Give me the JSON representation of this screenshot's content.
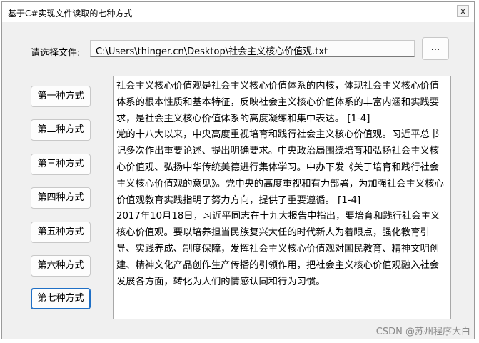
{
  "window": {
    "title": "基于C#实现文件读取的七种方式",
    "close_label": "x"
  },
  "file": {
    "label": "请选择文件:",
    "path": "C:\\Users\\thinger.cn\\Desktop\\社会主义核心价值观.txt",
    "browse_label": "..."
  },
  "methods": [
    {
      "label": "第一种方式"
    },
    {
      "label": "第二种方式"
    },
    {
      "label": "第三种方式"
    },
    {
      "label": "第四种方式"
    },
    {
      "label": "第五种方式"
    },
    {
      "label": "第六种方式"
    },
    {
      "label": "第七种方式"
    }
  ],
  "content": {
    "paragraphs": [
      "社会主义核心价值观是社会主义核心价值体系的内核，体现社会主义核心价值体系的根本性质和基本特征，反映社会主义核心价值体系的丰富内涵和实践要求，是社会主义核心价值体系的高度凝练和集中表达。 [1-4]",
      "党的十八大以来，中央高度重视培育和践行社会主义核心价值观。习近平总书记多次作出重要论述、提出明确要求。中央政治局围绕培育和弘扬社会主义核心价值观、弘扬中华传统美德进行集体学习。中办下发《关于培育和践行社会主义核心价值观的意见》。党中央的高度重视和有力部署，为加强社会主义核心价值观教育实践指明了努力方向，提供了重要遵循。 [1-4]",
      "2017年10月18日，习近平同志在十九大报告中指出，要培育和践行社会主义核心价值观。要以培养担当民族复兴大任的时代新人为着眼点，强化教育引导、实践养成、制度保障，发挥社会主义核心价值观对国民教育、精神文明创建、精神文化产品创作生产传播的引领作用，把社会主义核心价值观融入社会发展各方面，转化为人们的情感认同和行为习惯。"
    ]
  },
  "watermark": "CSDN @苏州程序大白"
}
